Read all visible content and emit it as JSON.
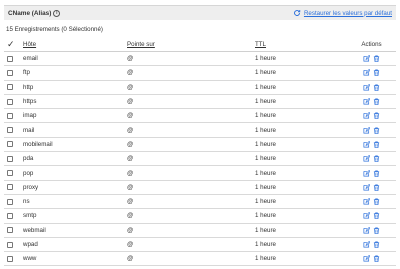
{
  "section": {
    "title": "CName (Alias)",
    "info_icon": "info-icon",
    "restore_label": "Restaurer les valeurs par défaut",
    "restore_icon": "refresh-icon"
  },
  "count_text": "15 Enregistrements (0 Sélectionné)",
  "table": {
    "headers": {
      "select_all": "checkmark",
      "host": "Hôte",
      "target": "Pointe sur",
      "ttl": "TTL",
      "actions": "Actions"
    },
    "rows": [
      {
        "host": "email",
        "target": "@",
        "ttl": "1 heure"
      },
      {
        "host": "ftp",
        "target": "@",
        "ttl": "1 heure"
      },
      {
        "host": "http",
        "target": "@",
        "ttl": "1 heure"
      },
      {
        "host": "https",
        "target": "@",
        "ttl": "1 heure"
      },
      {
        "host": "imap",
        "target": "@",
        "ttl": "1 heure"
      },
      {
        "host": "mail",
        "target": "@",
        "ttl": "1 heure"
      },
      {
        "host": "mobilemail",
        "target": "@",
        "ttl": "1 heure"
      },
      {
        "host": "pda",
        "target": "@",
        "ttl": "1 heure"
      },
      {
        "host": "pop",
        "target": "@",
        "ttl": "1 heure"
      },
      {
        "host": "proxy",
        "target": "@",
        "ttl": "1 heure"
      },
      {
        "host": "ns",
        "target": "@",
        "ttl": "1 heure"
      },
      {
        "host": "smtp",
        "target": "@",
        "ttl": "1 heure"
      },
      {
        "host": "webmail",
        "target": "@",
        "ttl": "1 heure"
      },
      {
        "host": "wpad",
        "target": "@",
        "ttl": "1 heure"
      },
      {
        "host": "www",
        "target": "@",
        "ttl": "1 heure"
      }
    ],
    "row_actions": [
      "edit-icon",
      "trash-icon"
    ]
  },
  "colors": {
    "accent": "#2a6fdb",
    "header_bg": "#eeeeee",
    "row_border": "#d9d9d9"
  }
}
